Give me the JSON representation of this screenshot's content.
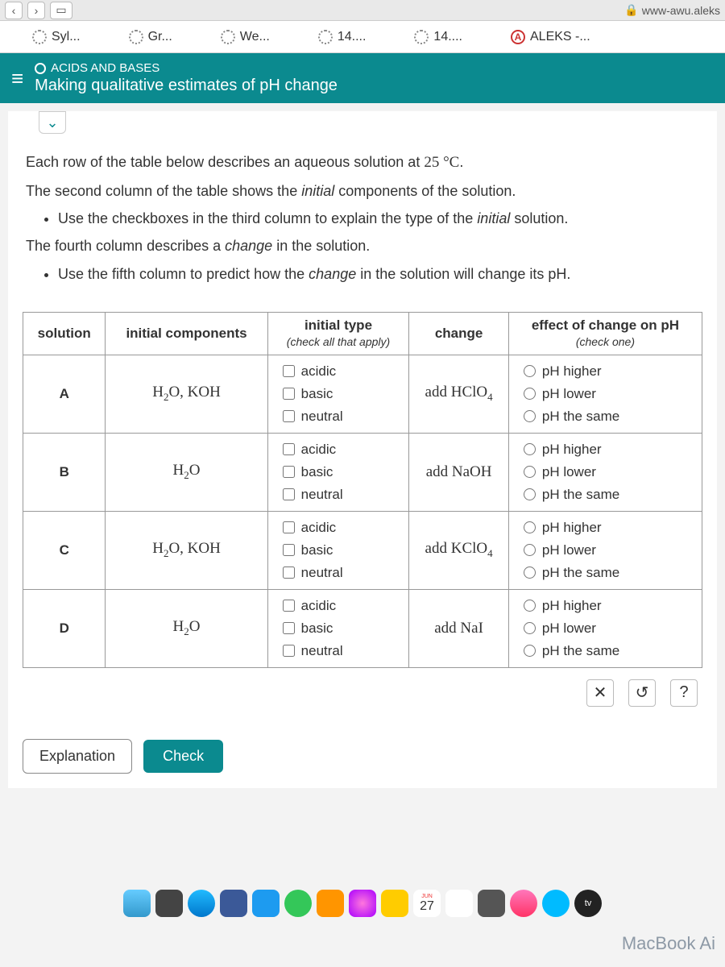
{
  "toolbar": {
    "url": "www-awu.aleks"
  },
  "tabs": [
    {
      "label": "Syl..."
    },
    {
      "label": "Gr..."
    },
    {
      "label": "We..."
    },
    {
      "label": "14...."
    },
    {
      "label": "14...."
    },
    {
      "label": "ALEKS -..."
    }
  ],
  "module": {
    "category": "ACIDS AND BASES",
    "title": "Making qualitative estimates of pH change"
  },
  "instructions": {
    "line1_a": "Each row of the table below describes an aqueous solution at ",
    "line1_b": "25 °C",
    "line1_c": ".",
    "line2_a": "The second column of the table shows the ",
    "line2_b": "initial",
    "line2_c": " components of the solution.",
    "bullet1_a": "Use the checkboxes in the third column to explain the type of the ",
    "bullet1_b": "initial",
    "bullet1_c": " solution.",
    "line3_a": "The fourth column describes a ",
    "line3_b": "change",
    "line3_c": " in the solution.",
    "bullet2_a": "Use the fifth column to predict how the ",
    "bullet2_b": "change",
    "bullet2_c": " in the solution will change its pH."
  },
  "headers": {
    "c1": "solution",
    "c2": "initial components",
    "c3": "initial type",
    "c3_hint": "(check all that apply)",
    "c4": "change",
    "c5": "effect of change on pH",
    "c5_hint": "(check one)"
  },
  "type_opts": [
    "acidic",
    "basic",
    "neutral"
  ],
  "effect_opts": [
    "pH higher",
    "pH lower",
    "pH the same"
  ],
  "rows": [
    {
      "id": "A",
      "components": "H<sub>2</sub>O, KOH",
      "change": "add HClO<sub>4</sub>"
    },
    {
      "id": "B",
      "components": "H<sub>2</sub>O",
      "change": "add NaOH"
    },
    {
      "id": "C",
      "components": "H<sub>2</sub>O, KOH",
      "change": "add KClO<sub>4</sub>"
    },
    {
      "id": "D",
      "components": "H<sub>2</sub>O",
      "change": "add NaI"
    }
  ],
  "actions": {
    "close": "✕",
    "undo": "↺",
    "help": "?"
  },
  "buttons": {
    "explain": "Explanation",
    "check": "Check"
  },
  "dock": {
    "calendar": "27",
    "calendar_month": "JUN",
    "tv": "tv"
  },
  "footer": "MacBook Ai"
}
